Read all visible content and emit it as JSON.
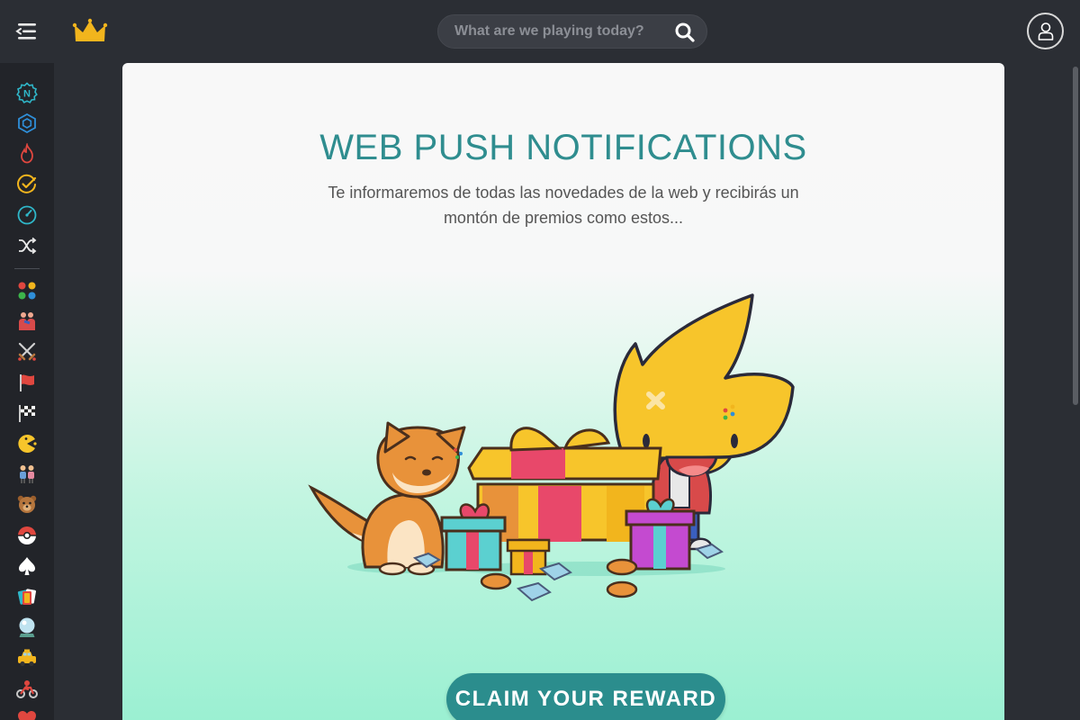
{
  "header": {
    "search_placeholder": "What are we playing today?"
  },
  "sidebar": {
    "items": [
      {
        "icon": "new-icon",
        "color": "#2fb7c9"
      },
      {
        "icon": "hexagon-icon",
        "color": "#2f8fd9"
      },
      {
        "icon": "flame-icon",
        "color": "#e0473f"
      },
      {
        "icon": "check-circle-icon",
        "color": "#f2b51d"
      },
      {
        "icon": "speedometer-icon",
        "color": "#2fb7c9"
      },
      {
        "icon": "shuffle-icon",
        "color": "#e8e8e8"
      },
      {
        "icon": "dots-grid-icon",
        "color": "#e0473f"
      },
      {
        "icon": "wrestlers-icon",
        "color": "#d84a4a"
      },
      {
        "icon": "crossed-swords-icon",
        "color": "#d0d0d0"
      },
      {
        "icon": "red-flag-icon",
        "color": "#e0473f"
      },
      {
        "icon": "checkered-flag-icon",
        "color": "#e8e8e8"
      },
      {
        "icon": "pacman-icon",
        "color": "#f7c52b"
      },
      {
        "icon": "couple-icon",
        "color": "#6a9fd8"
      },
      {
        "icon": "teddy-bear-icon",
        "color": "#b5763d"
      },
      {
        "icon": "pokeball-icon",
        "color": "#e0473f"
      },
      {
        "icon": "spade-icon",
        "color": "#ffffff"
      },
      {
        "icon": "playing-cards-icon",
        "color": "#e0473f"
      },
      {
        "icon": "crystal-ball-icon",
        "color": "#9fd3e8"
      },
      {
        "icon": "taxi-icon",
        "color": "#f2b51d"
      },
      {
        "icon": "motorbike-icon",
        "color": "#e0473f"
      },
      {
        "icon": "heart-icon",
        "color": "#e0473f"
      }
    ]
  },
  "main": {
    "title": "WEB PUSH NOTIFICATIONS",
    "subtitle": "Te informaremos de todas las novedades de la web y recibirás un montón de premios como estos...",
    "claim_label": "CLAIM YOUR REWARD"
  },
  "colors": {
    "accent": "#2b8d8d",
    "title": "#2f8d8f",
    "crown": "#f2b51d",
    "background": "#2b2e34"
  }
}
